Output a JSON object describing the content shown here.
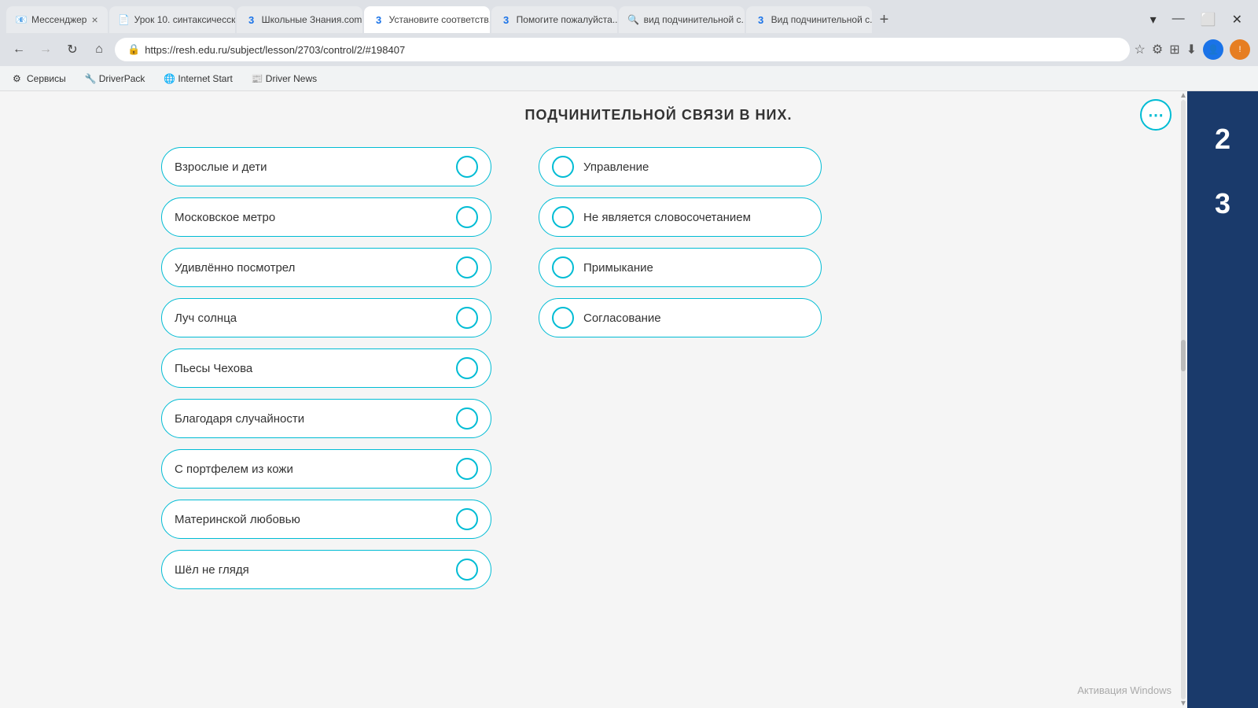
{
  "browser": {
    "tabs": [
      {
        "id": "tab1",
        "label": "Мессенджер",
        "favicon": "📧",
        "active": false
      },
      {
        "id": "tab2",
        "label": "Урок 10. синтаксичесск...",
        "favicon": "📄",
        "active": false
      },
      {
        "id": "tab3",
        "label": "Школьные Знания.com",
        "favicon": "3",
        "active": false
      },
      {
        "id": "tab4",
        "label": "Установите соответств...",
        "favicon": "3",
        "active": true
      },
      {
        "id": "tab5",
        "label": "Помогите пожалуйста...",
        "favicon": "3",
        "active": false
      },
      {
        "id": "tab6",
        "label": "вид подчинительной с...",
        "favicon": "🔍",
        "active": false
      },
      {
        "id": "tab7",
        "label": "Вид подчинительной с...",
        "favicon": "3",
        "active": false
      }
    ],
    "url": "https://resh.edu.ru/subject/lesson/2703/control/2/#198407"
  },
  "bookmarks": [
    {
      "label": "Сервисы",
      "favicon": "⚙"
    },
    {
      "label": "DriverPack",
      "favicon": "🔧"
    },
    {
      "label": "Internet Start",
      "favicon": "🌐"
    },
    {
      "label": "Driver News",
      "favicon": "📰"
    }
  ],
  "page": {
    "title": "ПОДЧИНИТЕЛЬНОЙ СВЯЗИ В НИХ.",
    "sidebar_numbers": [
      "2",
      "3"
    ],
    "left_items": [
      "Взрослые и дети",
      "Московское метро",
      "Удивлённо посмотрел",
      "Луч солнца",
      "Пьесы Чехова",
      "Благодаря случайности",
      "С портфелем из кожи",
      "Материнской любовью",
      "Шёл не глядя"
    ],
    "right_items": [
      "Управление",
      "Не является словосочетанием",
      "Примыкание",
      "Согласование"
    ],
    "activation_text": "Активация Windows"
  }
}
